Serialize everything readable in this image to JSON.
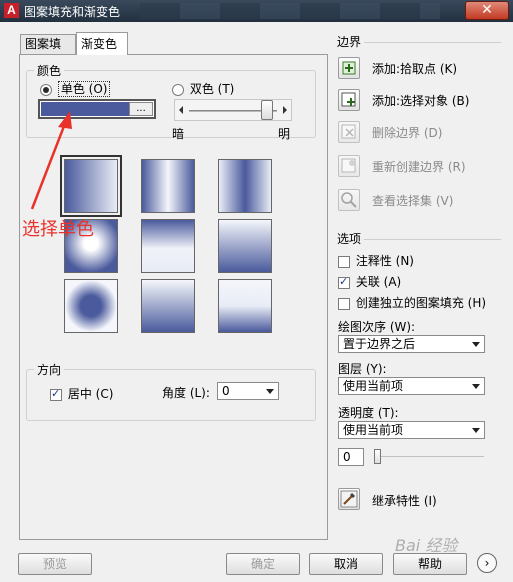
{
  "window": {
    "title": "图案填充和渐变色",
    "close_glyph": "✕"
  },
  "tabs": [
    {
      "label": "图案填充"
    },
    {
      "label": "渐变色"
    }
  ],
  "color": {
    "legend": "颜色",
    "single_label": "单色 (O)",
    "double_label": "双色 (T)",
    "swatch_color": "#4a5a9c",
    "swatch_button": "...",
    "dark_label": "暗",
    "light_label": "明",
    "shade_level": 0.95
  },
  "annotation": {
    "text": "选择单色",
    "color": "#e8322a"
  },
  "direction": {
    "legend": "方向",
    "center_label": "居中 (C)",
    "angle_label": "角度 (L):",
    "angle_value": "0"
  },
  "boundary": {
    "legend": "边界",
    "add_pick_points": "添加:拾取点 (K)",
    "add_select_objects": "添加:选择对象 (B)",
    "remove_boundaries": "删除边界 (D)",
    "recreate_boundary": "重新创建边界 (R)",
    "view_selections": "查看选择集 (V)"
  },
  "options": {
    "legend": "选项",
    "annotative": "注释性 (N)",
    "associative": "关联 (A)",
    "create_separate": "创建独立的图案填充 (H)",
    "draw_order_label": "绘图次序 (W):",
    "draw_order_value": "置于边界之后",
    "layer_label": "图层 (Y):",
    "layer_value": "使用当前项",
    "transparency_label": "透明度 (T):",
    "transparency_mode": "使用当前项",
    "transparency_value": "0"
  },
  "inherit": {
    "label": "继承特性 (I)"
  },
  "buttons": {
    "preview": "预览",
    "ok": "确定",
    "cancel": "取消",
    "help": "帮助"
  },
  "watermark": "Bai 经验",
  "icons": {
    "accent": "#3a7a2a"
  }
}
